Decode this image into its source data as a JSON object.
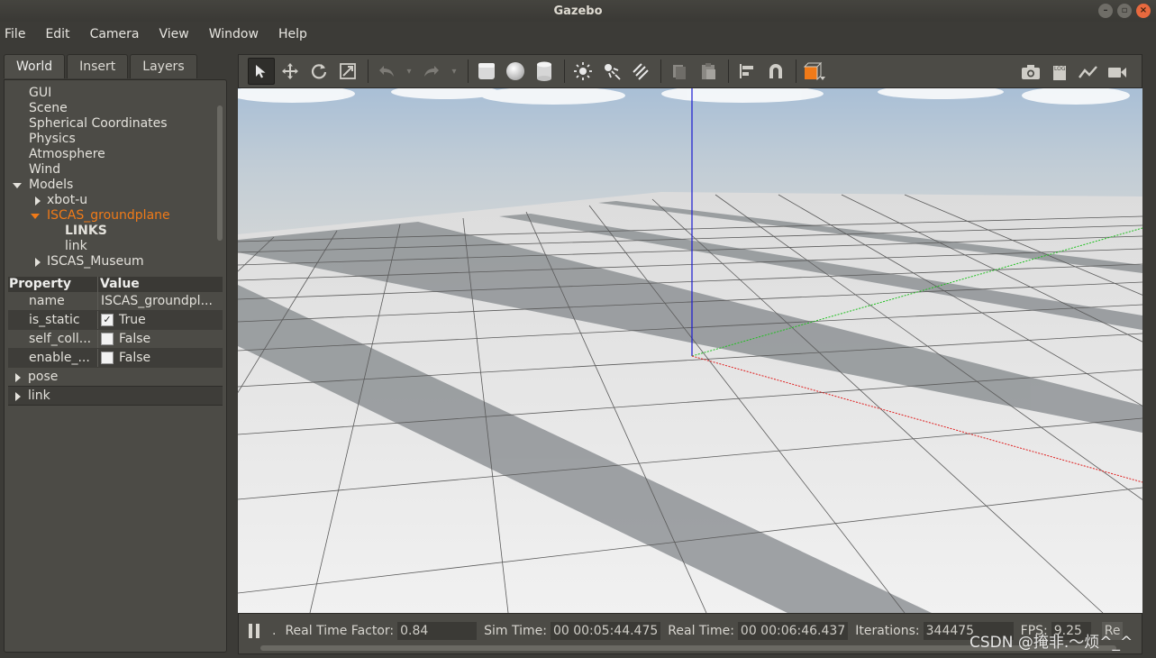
{
  "window": {
    "title": "Gazebo"
  },
  "menu": [
    "File",
    "Edit",
    "Camera",
    "View",
    "Window",
    "Help"
  ],
  "left_tabs": [
    "World",
    "Insert",
    "Layers"
  ],
  "tree": {
    "items": [
      {
        "label": "GUI"
      },
      {
        "label": "Scene"
      },
      {
        "label": "Spherical Coordinates"
      },
      {
        "label": "Physics"
      },
      {
        "label": "Atmosphere"
      },
      {
        "label": "Wind"
      },
      {
        "label": "Models"
      },
      {
        "label": "xbot-u"
      },
      {
        "label": "ISCAS_groundplane"
      },
      {
        "label": "LINKS"
      },
      {
        "label": "link"
      },
      {
        "label": "ISCAS_Museum"
      }
    ],
    "selected": "ISCAS_groundplane"
  },
  "properties": {
    "header": {
      "property": "Property",
      "value": "Value"
    },
    "rows": [
      {
        "key": "name",
        "value": "ISCAS_groundpl..."
      },
      {
        "key": "is_static",
        "value": "True",
        "checked": true
      },
      {
        "key": "self_coll...",
        "value": "False",
        "checked": false
      },
      {
        "key": "enable_...",
        "value": "False",
        "checked": false
      }
    ],
    "groups": [
      "pose",
      "link"
    ]
  },
  "toolbar": {
    "left_icons": [
      "select-mode-icon",
      "translate-icon",
      "rotate-icon",
      "scale-icon",
      "undo-icon",
      "undo-history-icon",
      "redo-icon",
      "redo-history-icon",
      "box-icon",
      "sphere-icon",
      "cylinder-icon",
      "point-light-icon",
      "spot-light-icon",
      "directional-light-icon",
      "copy-icon",
      "paste-icon",
      "align-icon",
      "snap-icon",
      "view-angle-icon"
    ],
    "right_icons": [
      "screenshot-icon",
      "log-icon",
      "plot-icon",
      "video-record-icon"
    ]
  },
  "status": {
    "real_time_factor_label": "Real Time Factor:",
    "real_time_factor": "0.84",
    "sim_time_label": "Sim Time:",
    "sim_time": "00 00:05:44.475",
    "real_time_label": "Real Time:",
    "real_time": "00 00:06:46.437",
    "iterations_label": "Iterations:",
    "iterations": "344475",
    "fps_label": "FPS:",
    "fps": "9.25",
    "reset_label": "Re"
  },
  "watermark": "CSDN @掩非.～烦^_^",
  "colors": {
    "selected_text": "#f07a18",
    "x_axis": "#e02020",
    "y_axis": "#20c020",
    "z_axis": "#1a1ad0"
  }
}
